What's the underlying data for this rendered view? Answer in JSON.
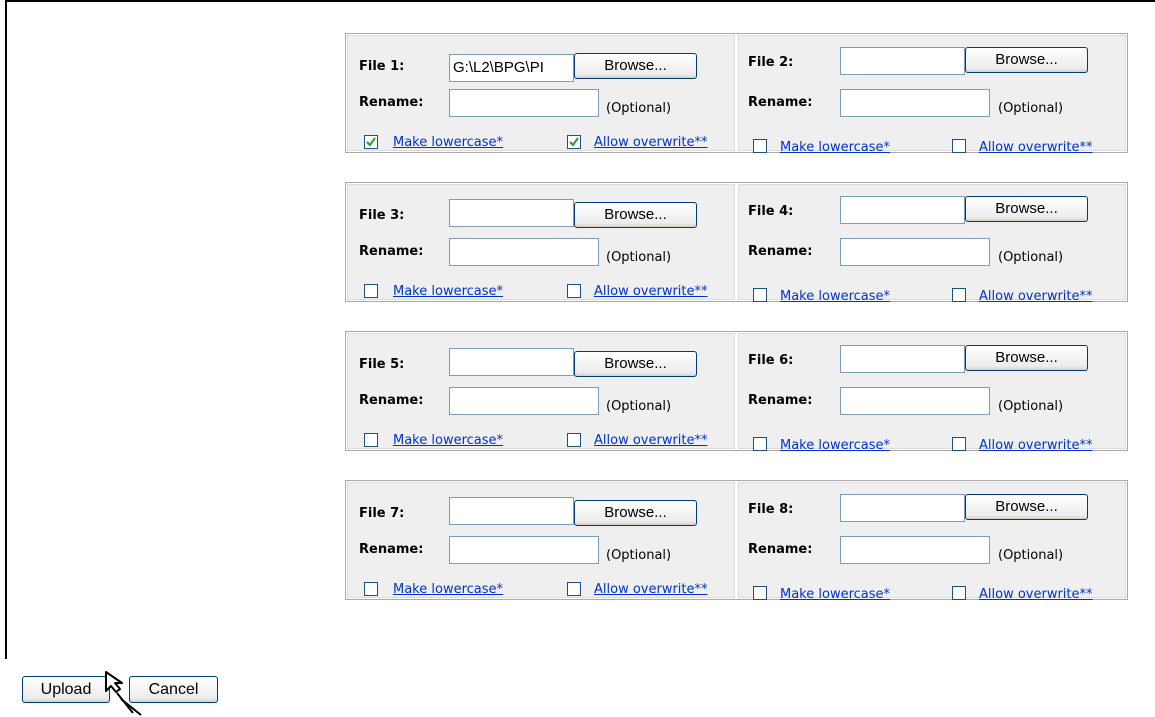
{
  "files": [
    {
      "label": "File 1:",
      "value": "G:\\L2\\BPG\\PI",
      "rename_label": "Rename:",
      "rename_value": "",
      "optional": "(Optional)",
      "browse": "Browse...",
      "lowercase_label": "Make lowercase*",
      "lowercase_checked": true,
      "overwrite_label": "Allow overwrite**",
      "overwrite_checked": true
    },
    {
      "label": "File 2:",
      "value": "",
      "rename_label": "Rename:",
      "rename_value": "",
      "optional": "(Optional)",
      "browse": "Browse...",
      "lowercase_label": "Make lowercase*",
      "lowercase_checked": false,
      "overwrite_label": "Allow overwrite**",
      "overwrite_checked": false
    },
    {
      "label": "File 3:",
      "value": "",
      "rename_label": "Rename:",
      "rename_value": "",
      "optional": "(Optional)",
      "browse": "Browse...",
      "lowercase_label": "Make lowercase*",
      "lowercase_checked": false,
      "overwrite_label": "Allow overwrite**",
      "overwrite_checked": false
    },
    {
      "label": "File 4:",
      "value": "",
      "rename_label": "Rename:",
      "rename_value": "",
      "optional": "(Optional)",
      "browse": "Browse...",
      "lowercase_label": "Make lowercase*",
      "lowercase_checked": false,
      "overwrite_label": "Allow overwrite**",
      "overwrite_checked": false
    },
    {
      "label": "File 5:",
      "value": "",
      "rename_label": "Rename:",
      "rename_value": "",
      "optional": "(Optional)",
      "browse": "Browse...",
      "lowercase_label": "Make lowercase*",
      "lowercase_checked": false,
      "overwrite_label": "Allow overwrite**",
      "overwrite_checked": false
    },
    {
      "label": "File 6:",
      "value": "",
      "rename_label": "Rename:",
      "rename_value": "",
      "optional": "(Optional)",
      "browse": "Browse...",
      "lowercase_label": "Make lowercase*",
      "lowercase_checked": false,
      "overwrite_label": "Allow overwrite**",
      "overwrite_checked": false
    },
    {
      "label": "File 7:",
      "value": "",
      "rename_label": "Rename:",
      "rename_value": "",
      "optional": "(Optional)",
      "browse": "Browse...",
      "lowercase_label": "Make lowercase*",
      "lowercase_checked": false,
      "overwrite_label": "Allow overwrite**",
      "overwrite_checked": false
    },
    {
      "label": "File 8:",
      "value": "",
      "rename_label": "Rename:",
      "rename_value": "",
      "optional": "(Optional)",
      "browse": "Browse...",
      "lowercase_label": "Make lowercase*",
      "lowercase_checked": false,
      "overwrite_label": "Allow overwrite**",
      "overwrite_checked": false
    }
  ],
  "actions": {
    "upload_label": "Upload",
    "cancel_label": "Cancel"
  },
  "icons": {
    "checkmark": "checkmark-icon",
    "cursor": "mouse-pointer-icon"
  },
  "colors": {
    "link": "#0033cc",
    "panel_bg": "#efefef",
    "checkmark": "#21a121"
  }
}
